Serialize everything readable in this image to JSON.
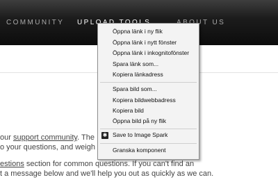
{
  "nav": {
    "items": [
      {
        "label": "COMMUNITY",
        "active": false
      },
      {
        "label": "UPLOAD TOOLS",
        "active": true
      },
      {
        "label": "ABOUT US",
        "active": false
      }
    ]
  },
  "content": {
    "line1": {
      "prefix": "our ",
      "link": "support community",
      "suffix": ". The Ima"
    },
    "line2": "o your questions, and weigh in o",
    "line3": {
      "link": "estions",
      "suffix": " section for common questions. If you can't find an"
    },
    "line4": "t a message below and we'll help you out as quickly as we can."
  },
  "context_menu": {
    "group1": [
      "Öppna länk i ny flik",
      "Öppna länk i nytt fönster",
      "Öppna länk i inkognitofönster",
      "Spara länk som...",
      "Kopiera länkadress"
    ],
    "group2": [
      "Spara bild som...",
      "Kopiera bildwebbadress",
      "Kopiera bild",
      "Öppna bild på ny flik"
    ],
    "extension": {
      "label": "Save to Image Spark",
      "icon": "image-spark-icon"
    },
    "inspect": "Granska komponent"
  }
}
